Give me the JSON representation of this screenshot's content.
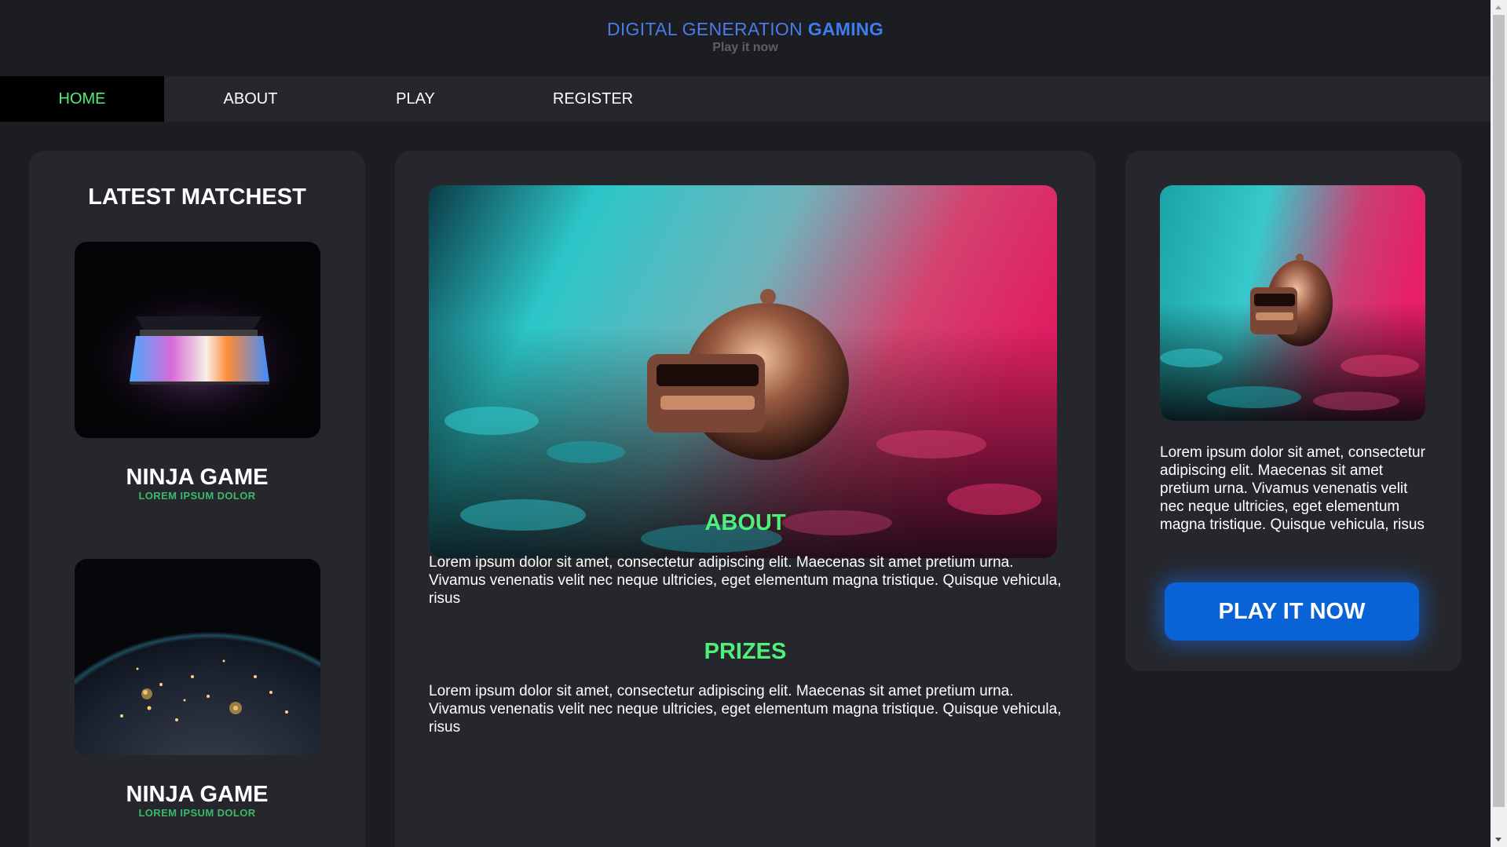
{
  "header": {
    "brand_prefix": "DIGITAL GENERATION ",
    "brand_bold": "GAMING",
    "tagline": "Play it now"
  },
  "nav": {
    "items": [
      {
        "label": "HOME",
        "active": true
      },
      {
        "label": "ABOUT",
        "active": false
      },
      {
        "label": "PLAY",
        "active": false
      },
      {
        "label": "REGISTER",
        "active": false
      }
    ]
  },
  "left_panel": {
    "heading": "LATEST MATCHEST",
    "games": [
      {
        "title": "NINJA GAME",
        "subtitle": "LOREM IPSUM DOLOR"
      },
      {
        "title": "NINJA GAME",
        "subtitle": "LOREM IPSUM DOLOR"
      }
    ]
  },
  "main": {
    "about_title": "ABOUT",
    "about_text": "Lorem ipsum dolor sit amet, consectetur adipiscing elit. Maecenas sit amet pretium urna. Vivamus venenatis velit nec neque ultricies, eget elementum magna tristique. Quisque vehicula, risus",
    "prizes_title": "PRIZES",
    "prizes_text": "Lorem ipsum dolor sit amet, consectetur adipiscing elit. Maecenas sit amet pretium urna. Vivamus venenatis velit nec neque ultricies, eget elementum magna tristique. Quisque vehicula, risus"
  },
  "right_panel": {
    "text": "Lorem ipsum dolor sit amet, consectetur adipiscing elit. Maecenas sit amet pretium urna. Vivamus venenatis velit nec neque ultricies, eget elementum magna tristique. Quisque vehicula, risus",
    "button_label": "PLAY IT NOW"
  },
  "colors": {
    "page_bg": "#1c1d21",
    "panel_bg": "#26272c",
    "brand_blue": "#3f7cf0",
    "accent_green": "#4ef07a",
    "button_blue": "#0a63d6"
  }
}
